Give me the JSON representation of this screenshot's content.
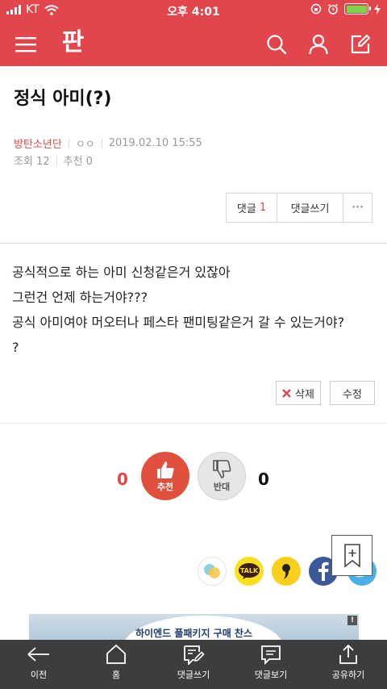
{
  "status_bar": {
    "carrier": "KT",
    "time": "오후 4:01"
  },
  "header": {
    "logo": "판"
  },
  "post": {
    "title": "정식 아미(?)",
    "author": "방탄소년단",
    "nickname": "ㅇㅇ",
    "datetime": "2019.02.10 15:55",
    "views_label": "조회 12",
    "recommend_label": "추천 0"
  },
  "comment_bar": {
    "comments_label": "댓글",
    "comments_count": "1",
    "write_label": "댓글쓰기",
    "more_label": "···"
  },
  "body_lines": [
    "공식적으로 하는 아미 신청같은거 있잖아",
    "그런건 언제 하는거야???",
    "공식 아미여야 머오터나 페스타 팬미팅같은거 갈 수 있는거야?",
    "?"
  ],
  "actions": {
    "delete_label": "삭제",
    "edit_label": "수정"
  },
  "votes": {
    "up_count": "0",
    "up_label": "추천",
    "down_count": "0",
    "down_label": "반대"
  },
  "share": {
    "kakaotalk_label": "TALK"
  },
  "banner": {
    "text": "하이엔드 풀패키지 구매 찬스",
    "ad_mark": "!"
  },
  "bottom_nav": [
    {
      "label": "이전"
    },
    {
      "label": "홈"
    },
    {
      "label": "댓글쓰기"
    },
    {
      "label": "댓글보기"
    },
    {
      "label": "공유하기"
    }
  ],
  "colors": {
    "brand": "#e0464b",
    "nav_bg": "#3d3d3d",
    "battery": "#7ed34b"
  }
}
